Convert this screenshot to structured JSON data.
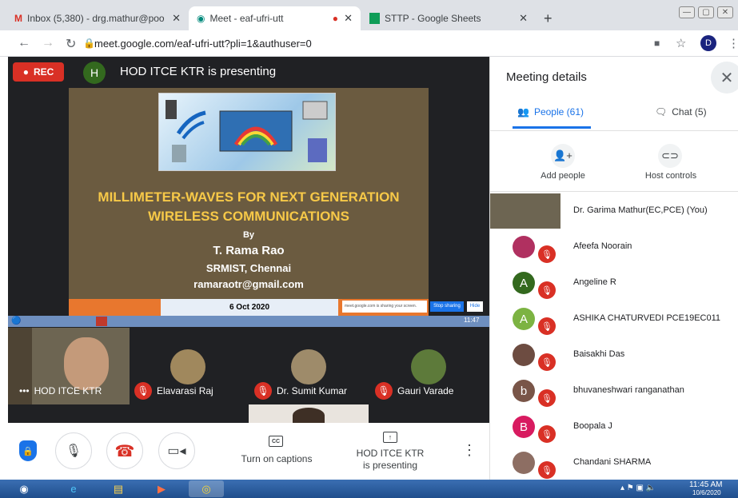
{
  "tabs": [
    {
      "title": "Inbox (5,380) - drg.mathur@poo",
      "icon": "gmail-icon"
    },
    {
      "title": "Meet - eaf-ufri-utt",
      "icon": "meet-icon"
    },
    {
      "title": "STTP - Google Sheets",
      "icon": "sheets-icon"
    }
  ],
  "new_tab": "+",
  "address": {
    "url": "meet.google.com/eaf-ufri-utt?pli=1&authuser=0",
    "profile_initial": "D"
  },
  "meeting": {
    "rec_label": "REC",
    "presenter_initial": "H",
    "presenter_banner": "HOD ITCE KTR is presenting"
  },
  "slide": {
    "title_line1": "MILLIMETER-WAVES  FOR NEXT GENERATION",
    "title_line2": "WIRELESS COMMUNICATIONS",
    "by": "By",
    "author": "T. Rama Rao",
    "affiliation": "SRMIST, Chennai",
    "email": "ramaraotr@gmail.com",
    "date": "6 Oct 2020",
    "share_notice": "meet.google.com is sharing your screen.",
    "stop_sharing": "Stop sharing",
    "hide": "Hide",
    "clock": "11:47"
  },
  "thumbnails": [
    {
      "name": "HOD ITCE KTR"
    },
    {
      "name": "Elavarasi Raj"
    },
    {
      "name": "Dr. Sumit Kumar"
    },
    {
      "name": "Gauri Varade"
    }
  ],
  "controls": {
    "captions_label": "Turn on captions",
    "captions_icon_text": "CC",
    "present_label_line1": "HOD ITCE KTR",
    "present_label_line2": "is presenting"
  },
  "panel": {
    "title": "Meeting details",
    "tab_people": "People (61)",
    "tab_chat": "Chat (5)",
    "add_people": "Add people",
    "host_controls": "Host controls",
    "accent": "#1a73e8",
    "people": [
      {
        "name": "Dr. Garima Mathur(EC,PCE) (You)",
        "initial": "",
        "color": "#555"
      },
      {
        "name": "Afeefa Noorain",
        "initial": "",
        "color": "#b03060"
      },
      {
        "name": "Angeline R",
        "initial": "A",
        "color": "#33691e"
      },
      {
        "name": "ASHIKA CHATURVEDI PCE19EC011",
        "initial": "A",
        "color": "#7cb342"
      },
      {
        "name": "Baisakhi Das",
        "initial": "",
        "color": "#6d4c41"
      },
      {
        "name": "bhuvaneshwari ranganathan",
        "initial": "b",
        "color": "#795548"
      },
      {
        "name": "Boopala J",
        "initial": "B",
        "color": "#d81b60"
      },
      {
        "name": "Chandani SHARMA",
        "initial": "",
        "color": "#8d6e63"
      }
    ]
  },
  "taskbar": {
    "time": "11:45 AM",
    "date": "10/6/2020"
  }
}
